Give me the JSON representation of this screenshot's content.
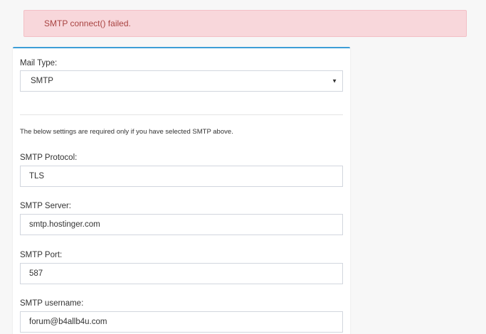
{
  "alert": {
    "message": "SMTP connect() failed."
  },
  "form": {
    "mail_type": {
      "label": "Mail Type:",
      "selected": "SMTP"
    },
    "help_text": "The below settings are required only if you have selected SMTP above.",
    "smtp_protocol": {
      "label": "SMTP Protocol:",
      "value": "TLS"
    },
    "smtp_server": {
      "label": "SMTP Server:",
      "value": "smtp.hostinger.com"
    },
    "smtp_port": {
      "label": "SMTP Port:",
      "value": "587"
    },
    "smtp_username": {
      "label": "SMTP username:",
      "value": "forum@b4allb4u.com"
    }
  },
  "icons": {
    "dropdown": "caret-down-icon"
  },
  "colors": {
    "alert_bg": "#f8d7db",
    "alert_text": "#a94442",
    "panel_accent": "#3c9dd6"
  }
}
